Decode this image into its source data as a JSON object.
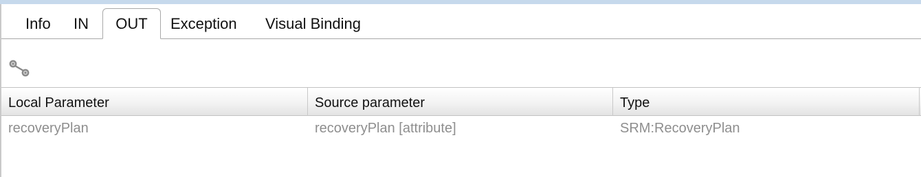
{
  "tabs": [
    {
      "label": "Info",
      "active": false
    },
    {
      "label": "IN",
      "active": false
    },
    {
      "label": "OUT",
      "active": true
    },
    {
      "label": "Exception",
      "active": false
    },
    {
      "label": "Visual Binding",
      "active": false
    }
  ],
  "toolbar": {
    "bind_icon": "link-binding-icon"
  },
  "table": {
    "columns": [
      "Local Parameter",
      "Source parameter",
      "Type"
    ],
    "rows": [
      [
        "recoveryPlan",
        "recoveryPlan [attribute]",
        "SRM:RecoveryPlan"
      ]
    ]
  },
  "colors": {
    "top_strip": "#c6d9ec",
    "cell_text": "#8e8e8e",
    "header_text": "#111111"
  }
}
